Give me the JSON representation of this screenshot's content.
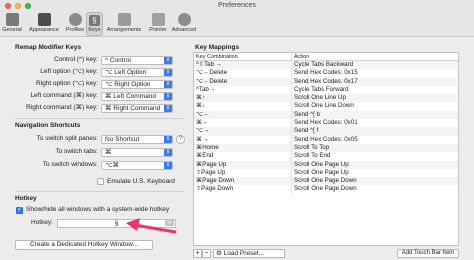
{
  "window": {
    "title": "Preferences"
  },
  "toolbar": {
    "items": [
      {
        "label": "General",
        "icon": "switch-icon",
        "color": "#7a7a7a"
      },
      {
        "label": "Appearance",
        "icon": "appearance-icon",
        "color": "#4d4d4d"
      },
      {
        "label": "Profiles",
        "icon": "profiles-icon",
        "color": "#8a8a8a"
      },
      {
        "label": "Keys",
        "icon": "keys-icon",
        "color": "#777777"
      },
      {
        "label": "Arrangements",
        "icon": "arrangements-icon",
        "color": "#9a9a9a"
      },
      {
        "label": "Pointer",
        "icon": "pointer-icon",
        "color": "#a0a0a0"
      },
      {
        "label": "Advanced",
        "icon": "gear-icon",
        "color": "#8c8c8c"
      }
    ],
    "active": "Keys"
  },
  "remap": {
    "title": "Remap Modifier Keys",
    "rows": [
      {
        "label": "Control (^) key:",
        "value": "^ Control"
      },
      {
        "label": "Left option (⌥) key:",
        "value": "⌥ Left Option"
      },
      {
        "label": "Right option (⌥) key:",
        "value": "⌥ Right Option"
      },
      {
        "label": "Left command (⌘) key:",
        "value": "⌘ Left Command"
      },
      {
        "label": "Right command (⌘) key:",
        "value": "⌘ Right Command"
      }
    ]
  },
  "nav": {
    "title": "Navigation Shortcuts",
    "rows": [
      {
        "label": "To switch split panes:",
        "value": "No Shortcut"
      },
      {
        "label": "To switch tabs:",
        "value": "⌘"
      },
      {
        "label": "To switch windows:",
        "value": "⌥⌘"
      }
    ],
    "emulate_label": "Emulate U.S. Keyboard"
  },
  "hotkey": {
    "title": "Hotkey",
    "show_hide_label": "Show/hide all windows with a system-wide hotkey",
    "hotkey_label": "Hotkey:",
    "hotkey_value": "§",
    "create_button": "Create a Dedicated Hotkey Window..."
  },
  "key_mappings": {
    "title": "Key Mappings",
    "columns": [
      "Key Combination",
      "Action"
    ],
    "rows": [
      [
        "^⇧Tab →",
        "Cycle Tabs Backward"
      ],
      [
        "⌥←Delete",
        "Send Hex Codes: 0x15"
      ],
      [
        "⌥←Delete",
        "Send Hex Codes: 0x17"
      ],
      [
        "^Tab→",
        "Cycle Tabs Forward"
      ],
      [
        "⌘↑",
        "Scroll One Line Up"
      ],
      [
        "⌘↓",
        "Scroll One Line Down"
      ],
      [
        "⌥←",
        "Send ^[ b"
      ],
      [
        "⌘←",
        "Send Hex Codes: 0x01"
      ],
      [
        "⌥→",
        "Send ^[ f"
      ],
      [
        "⌘→",
        "Send Hex Codes: 0x05"
      ],
      [
        "⌘Home",
        "Scroll To Top"
      ],
      [
        "⌘End",
        "Scroll To End"
      ],
      [
        "⌘Page Up",
        "Scroll One Page Up"
      ],
      [
        "⇧Page Up",
        "Scroll One Page Up"
      ],
      [
        "⌘Page Down",
        "Scroll One Page Down"
      ],
      [
        "⇧Page Down",
        "Scroll One Page Down"
      ]
    ],
    "add_label": "+",
    "remove_label": "−",
    "gear_label": "⚙",
    "load_preset": "Load Preset...",
    "add_touch_bar": "Add Touch Bar Item"
  },
  "colors": {
    "accent": "#3a7bf0",
    "annotation_arrow": "#e8386b"
  }
}
